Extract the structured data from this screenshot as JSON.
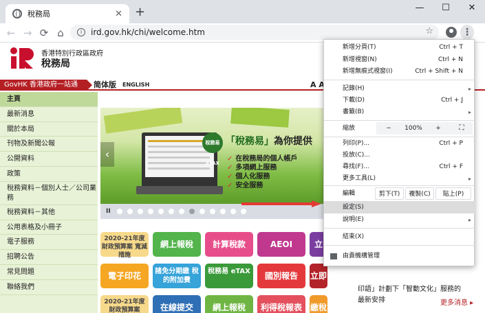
{
  "browser": {
    "tab_title": "稅務局",
    "tab_close": "✕",
    "new_tab": "+",
    "window_controls": [
      "—",
      "☐",
      "✕"
    ],
    "url": "ird.gov.hk/chi/welcome.htm",
    "back_icon": "←",
    "forward_icon": "→",
    "reload_icon": "⟳",
    "home_icon": "⌂",
    "star_icon": "☆",
    "menu_icon": "⋮"
  },
  "site": {
    "org_line1": "香港特別行政區政府",
    "org_line2": "稅務局",
    "govhk_link": "GovHK 香港政府一站通",
    "lang_simplified": "简体版",
    "lang_english": "ENGLISH",
    "font_size_controls": "A A",
    "sidebar": [
      "主頁",
      "最新消息",
      "關於本局",
      "刊物及新聞公報",
      "公開資料",
      "政策",
      "稅務資料－個別人士／公司業務",
      "稅務資料－其他",
      "公用表格及小冊子",
      "電子服務",
      "招聘公告",
      "常見問題",
      "聯絡我們"
    ],
    "banner": {
      "etax_badge": "稅務易 eTAX",
      "headline_a": "「稅務易」",
      "headline_b": "為你提供",
      "bullets": [
        "在稅務局的個人帳戶",
        "多項網上服務",
        "個人化服務",
        "安全服務"
      ],
      "prev": "‹",
      "pause": "II"
    },
    "tiles": [
      "2020-21年度 財政預算案 寬減措施",
      "網上報稅",
      "計算稅款",
      "AEOI",
      "立",
      "電子印花",
      "諸免分期繳 稅的附加費",
      "稅務易 eTAX",
      "國別報告",
      "立即",
      "2020-21年度 財政預算案",
      "在線提交",
      "網上報稅",
      "利得稅報表",
      "繳稅"
    ],
    "news": {
      "line1": "印語」計劃下「智動文化」服務的",
      "line2": "最新安排",
      "more": "更多消息 ▸"
    }
  },
  "chrome_menu": {
    "new_tab": {
      "label": "新增分頁(T)",
      "shortcut": "Ctrl + T"
    },
    "new_window": {
      "label": "新增視窗(N)",
      "shortcut": "Ctrl + N"
    },
    "new_incognito": {
      "label": "新增無痕式視窗(I)",
      "shortcut": "Ctrl + Shift + N"
    },
    "history": {
      "label": "記錄(H)"
    },
    "downloads": {
      "label": "下載(D)",
      "shortcut": "Ctrl + J"
    },
    "bookmarks": {
      "label": "書籤(B)"
    },
    "zoom": {
      "label": "縮放",
      "minus": "−",
      "value": "100%",
      "plus": "+",
      "fullscreen": "⛶"
    },
    "print": {
      "label": "列印(P)...",
      "shortcut": "Ctrl + P"
    },
    "cast": {
      "label": "投放(C)..."
    },
    "find": {
      "label": "尋找(F)...",
      "shortcut": "Ctrl + F"
    },
    "more_tools": {
      "label": "更多工具(L)"
    },
    "edit": {
      "label": "編輯",
      "cut": "剪下(T)",
      "copy": "複製(C)",
      "paste": "貼上(P)"
    },
    "settings": {
      "label": "設定(S)"
    },
    "help": {
      "label": "說明(E)"
    },
    "exit": {
      "label": "結束(X)"
    },
    "managed": {
      "label": "由貴機構管理"
    },
    "submenu_arrow": "▸"
  }
}
